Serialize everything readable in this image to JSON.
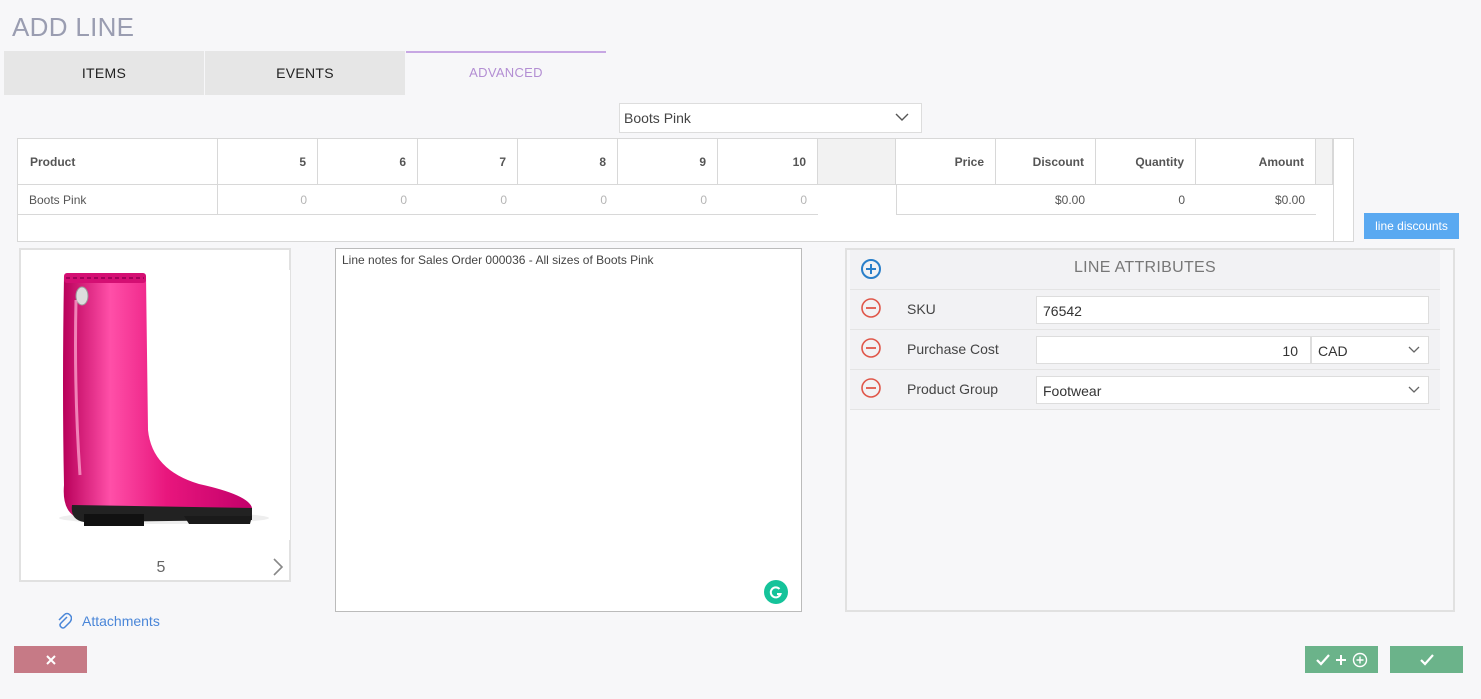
{
  "page": {
    "title": "ADD LINE"
  },
  "tabs": [
    {
      "label": "ITEMS"
    },
    {
      "label": "EVENTS"
    },
    {
      "label": "ADVANCED",
      "active": true
    }
  ],
  "product_select": {
    "value": "Boots Pink",
    "icon": "chevron-down-icon"
  },
  "grid": {
    "headers": {
      "product": "Product",
      "sizes": [
        "5",
        "6",
        "7",
        "8",
        "9",
        "10"
      ],
      "price": "Price",
      "discount": "Discount",
      "quantity": "Quantity",
      "amount": "Amount"
    },
    "rows": [
      {
        "product": "Boots Pink",
        "sizes": [
          "0",
          "0",
          "0",
          "0",
          "0",
          "0"
        ],
        "price": "",
        "discount": "$0.00",
        "quantity": "0",
        "amount": "$0.00"
      }
    ]
  },
  "line_discounts_label": "line discounts",
  "image_viewer": {
    "counter": "5",
    "next_icon": "chevron-right-icon"
  },
  "notes": {
    "value": "Line notes for Sales Order 000036 - All sizes of Boots Pink"
  },
  "attributes": {
    "title": "LINE ATTRIBUTES",
    "add_icon": "plus-circle-icon",
    "rows": [
      {
        "label": "SKU",
        "value": "76542"
      },
      {
        "label": "Purchase Cost",
        "value": "10",
        "currency": "CAD"
      },
      {
        "label": "Product Group",
        "value": "Footwear"
      }
    ]
  },
  "attachments_label": "Attachments",
  "colors": {
    "accent_tab": "#b38ed3",
    "primary_button": "#5aa9f1",
    "cancel_button": "#c67a86",
    "confirm_button": "#6bb38a",
    "boot": "#e8167d"
  }
}
